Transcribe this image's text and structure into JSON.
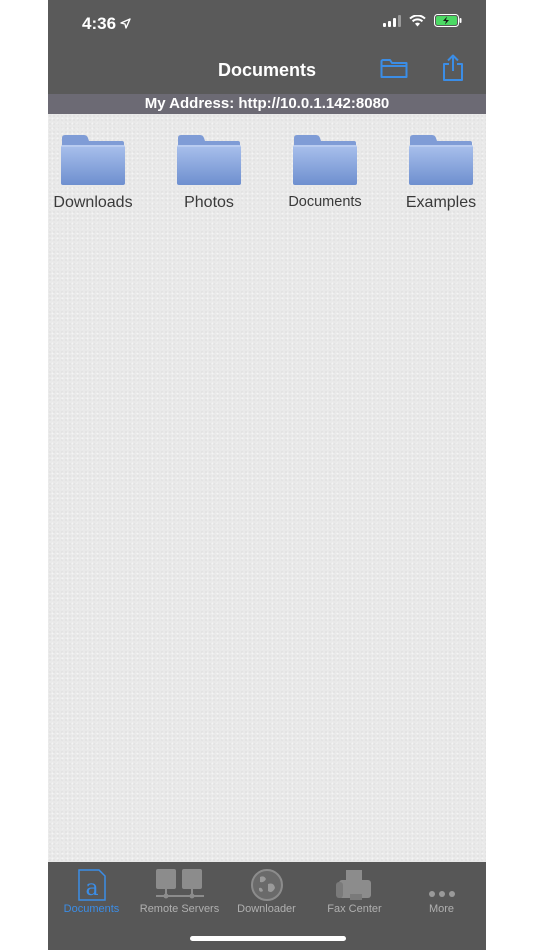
{
  "status_bar": {
    "time": "4:36"
  },
  "nav": {
    "title": "Documents",
    "folder_button_icon": "folder-outline-icon",
    "share_button_icon": "share-icon"
  },
  "address": {
    "text": "My Address: http://10.0.1.142:8080"
  },
  "folders": [
    {
      "label": "Downloads"
    },
    {
      "label": "Photos"
    },
    {
      "label": "Documents"
    },
    {
      "label": "Examples"
    }
  ],
  "tabs": [
    {
      "label": "Documents",
      "icon": "document-a-icon",
      "active": true
    },
    {
      "label": "Remote Servers",
      "icon": "servers-icon",
      "active": false
    },
    {
      "label": "Downloader",
      "icon": "globe-icon",
      "active": false
    },
    {
      "label": "Fax Center",
      "icon": "fax-icon",
      "active": false
    },
    {
      "label": "More",
      "icon": "more-dots-icon",
      "active": false
    }
  ],
  "colors": {
    "accent": "#3b8de6",
    "bar": "#5a5a5a",
    "address_bar": "#6c6a74",
    "folder": "#7e9fdc"
  }
}
